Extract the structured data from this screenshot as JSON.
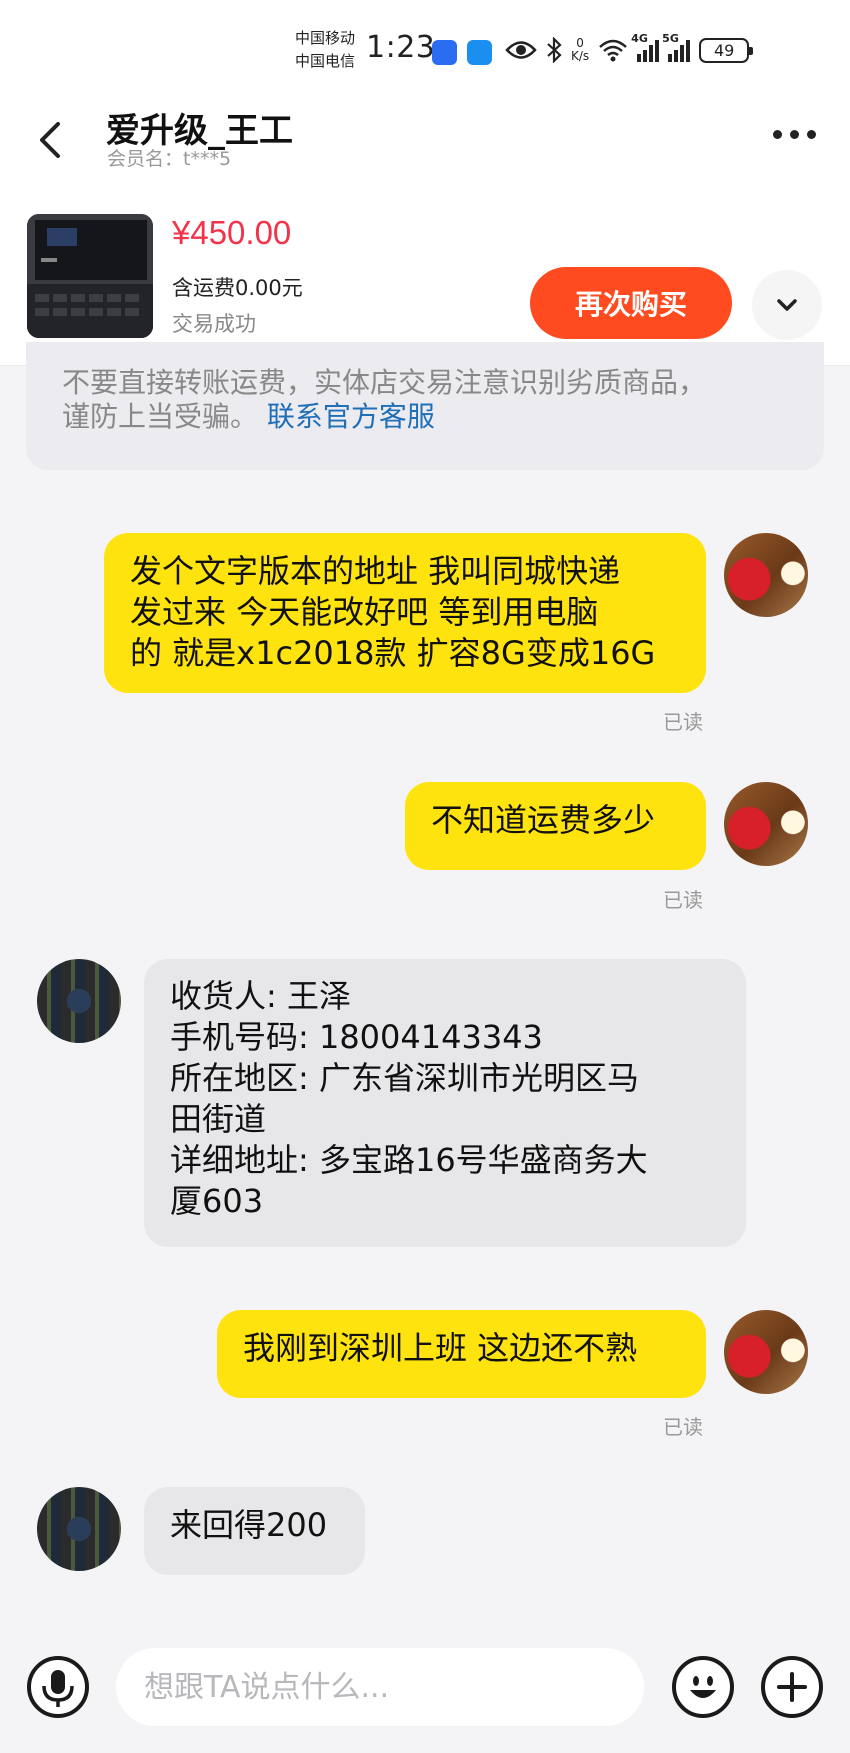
{
  "status_bar": {
    "carrier_1": "中国移动",
    "carrier_2": "中国电信",
    "time": "1:23",
    "net_speed_value": "0",
    "net_speed_unit": "K/s",
    "signal_1": "4G",
    "signal_2": "5G",
    "battery": "49"
  },
  "header": {
    "title": "爱升级_王工",
    "subtitle": "会员名：t***5"
  },
  "product": {
    "price": "¥450.00",
    "shipping": "含运费0.00元",
    "status": "交易成功",
    "buy_again_label": "再次购买"
  },
  "notice": {
    "line_1": "不要直接转账运费，实体店交易注意识别劣质商品，",
    "line_2": "谨防上当受骗。",
    "link": "联系官方客服"
  },
  "messages": [
    {
      "sender": "me",
      "text": "发个文字版本的地址 我叫同城快递\n发过来 今天能改好吧 等到用电脑\n的 就是x1c2018款 扩容8G变成16G",
      "status": "已读"
    },
    {
      "sender": "me",
      "text": "不知道运费多少",
      "status": "已读"
    },
    {
      "sender": "them",
      "text": "收货人: 王泽\n手机号码: 18004143343\n所在地区: 广东省深圳市光明区马\n田街道\n详细地址: 多宝路16号华盛商务大\n厦603"
    },
    {
      "sender": "me",
      "text": "我刚到深圳上班 这边还不熟",
      "status": "已读"
    },
    {
      "sender": "them",
      "text": "来回得200"
    }
  ],
  "input": {
    "placeholder": "想跟TA说点什么..."
  }
}
